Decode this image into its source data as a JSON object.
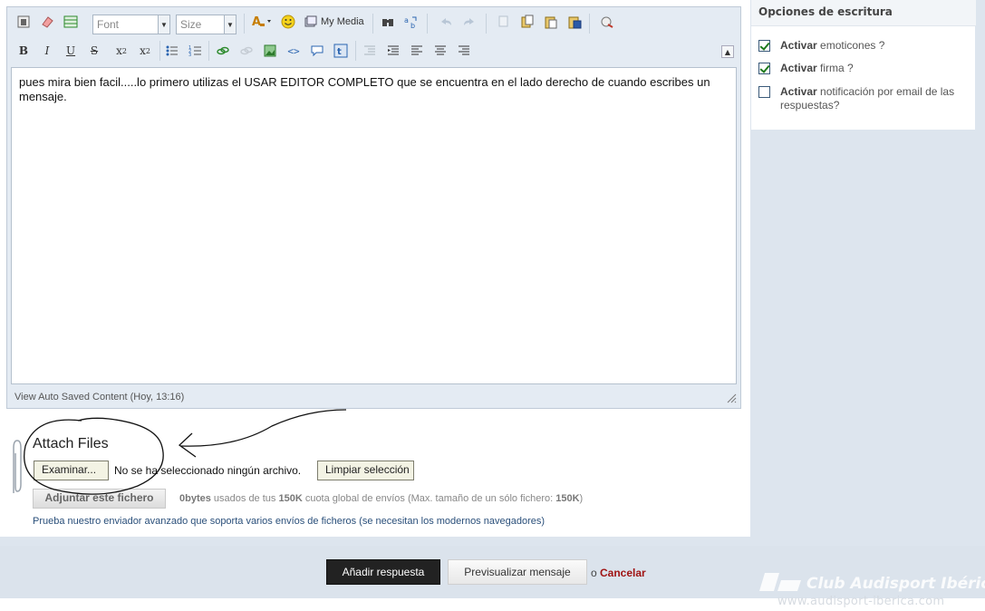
{
  "editor": {
    "font_select": "Font",
    "size_select": "Size",
    "my_media_label": "My Media",
    "content": "pues mira bien facil.....lo primero utilizas el USAR EDITOR COMPLETO que se encuentra en el lado derecho de cuando escribes un mensaje.",
    "autosave": "View Auto Saved Content (Hoy, 13:16)"
  },
  "attach": {
    "title": "Attach Files",
    "browse_label": "Examinar...",
    "no_file": "No se ha seleccionado ningún archivo.",
    "clear_label": "Limpiar selección",
    "upload_label": "Adjuntar este fichero",
    "quota_used": "0bytes",
    "quota_mid": " usados de tus ",
    "quota_total": "150K",
    "quota_end": " cuota global de envíos (Max. tamaño de un sólo fichero: ",
    "quota_max": "150K",
    "quota_close": ")",
    "advanced_link": "Prueba nuestro enviador avanzado que soporta varios envíos de ficheros (se necesitan los modernos navegadores)"
  },
  "options": {
    "header": "Opciones de escritura",
    "items": [
      {
        "bold": "Activar",
        "text": " emoticones ?",
        "checked": true
      },
      {
        "bold": "Activar",
        "text": " firma ?",
        "checked": true
      },
      {
        "bold": "Activar",
        "text": " notificación por email de las respuestas?",
        "checked": false
      }
    ]
  },
  "actions": {
    "submit_label": "Añadir respuesta",
    "preview_label": "Previsualizar mensaje",
    "or_text": "o",
    "cancel_label": "Cancelar"
  },
  "watermark": {
    "title": "Club Audisport Ibérica",
    "url": "www.audisport-iberica.com"
  },
  "colors": {
    "background": "#dde5ee",
    "editor_bg": "#e4ebf3",
    "cancel": "#a01414",
    "submit_bg": "#222222"
  }
}
